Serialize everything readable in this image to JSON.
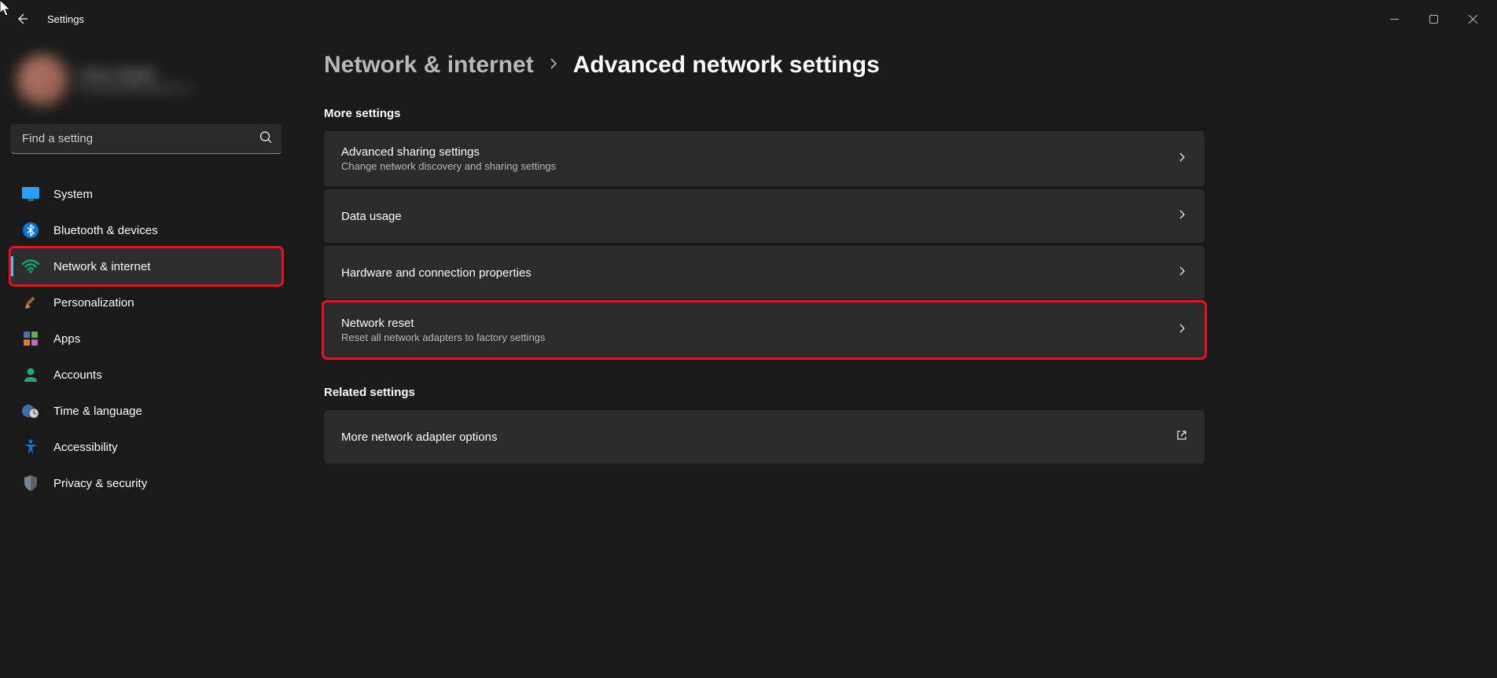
{
  "app": {
    "title": "Settings"
  },
  "search": {
    "placeholder": "Find a setting"
  },
  "sidebar": {
    "items": [
      {
        "id": "system",
        "label": "System"
      },
      {
        "id": "bluetooth",
        "label": "Bluetooth & devices"
      },
      {
        "id": "network",
        "label": "Network & internet"
      },
      {
        "id": "personalization",
        "label": "Personalization"
      },
      {
        "id": "apps",
        "label": "Apps"
      },
      {
        "id": "accounts",
        "label": "Accounts"
      },
      {
        "id": "time",
        "label": "Time & language"
      },
      {
        "id": "accessibility",
        "label": "Accessibility"
      },
      {
        "id": "privacy",
        "label": "Privacy & security"
      }
    ]
  },
  "breadcrumb": {
    "parent": "Network & internet",
    "current": "Advanced network settings"
  },
  "sections": {
    "more": {
      "heading": "More settings",
      "panels": [
        {
          "title": "Advanced sharing settings",
          "sub": "Change network discovery and sharing settings",
          "action": "chevron"
        },
        {
          "title": "Data usage",
          "sub": "",
          "action": "chevron"
        },
        {
          "title": "Hardware and connection properties",
          "sub": "",
          "action": "chevron"
        },
        {
          "title": "Network reset",
          "sub": "Reset all network adapters to factory settings",
          "action": "chevron"
        }
      ]
    },
    "related": {
      "heading": "Related settings",
      "panels": [
        {
          "title": "More network adapter options",
          "sub": "",
          "action": "external"
        }
      ]
    }
  }
}
